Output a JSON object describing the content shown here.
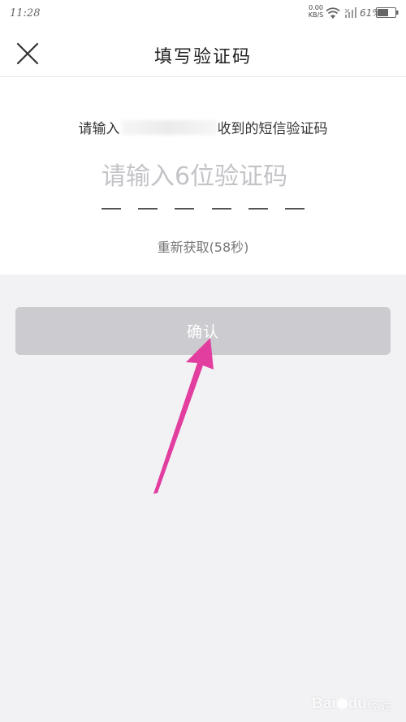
{
  "status_bar": {
    "time": "11:28",
    "net_speed_value": "0.00",
    "net_speed_unit": "KB/S",
    "battery_percent": "61%"
  },
  "header": {
    "title": "填写验证码"
  },
  "form": {
    "hint_prefix": "请输入",
    "hint_suffix": "收到的短信验证码",
    "code_placeholder": "请输入6位验证码",
    "code_value": "",
    "resend_text": "重新获取(58秒)"
  },
  "actions": {
    "confirm_label": "确认"
  },
  "annotation": {
    "arrow_color": "#e23ea0"
  },
  "watermark": {
    "brand": "Bai",
    "brand_suffix": "du",
    "sub": "经验"
  }
}
